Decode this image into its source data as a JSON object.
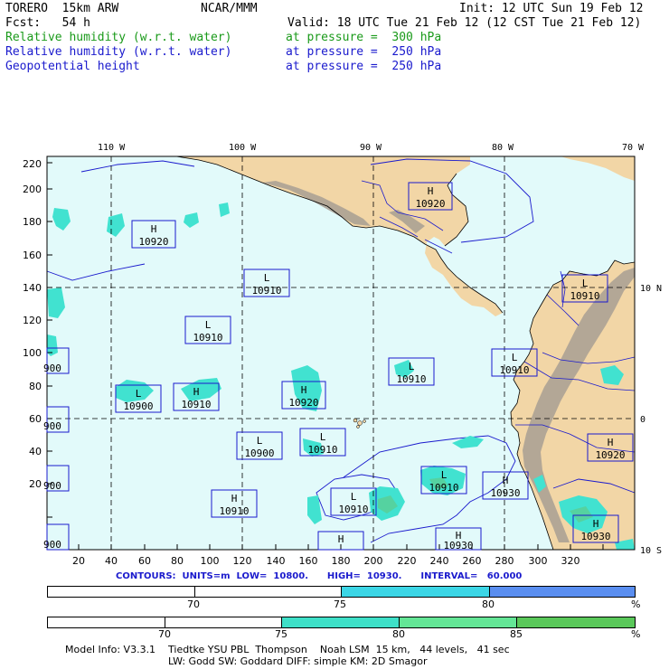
{
  "header": {
    "model": "TORERO  15km ARW",
    "org": "NCAR/MMM",
    "init": "Init: 12 UTC Sun 19 Feb 12",
    "fcst": "Fcst:   54 h",
    "valid": "Valid: 18 UTC Tue 21 Feb 12 (12 CST Tue 21 Feb 12)",
    "fields": [
      {
        "name": "Relative humidity (w.r.t. water)",
        "level": "at pressure =  300 hPa",
        "color": "#1a9a1a"
      },
      {
        "name": "Relative humidity (w.r.t. water)",
        "level": "at pressure =  250 hPa",
        "color": "#1a1acd"
      },
      {
        "name": "Geopotential height",
        "level": "at pressure =  250 hPa",
        "color": "#1a1acd"
      }
    ]
  },
  "map": {
    "lon_labels": [
      "110 W",
      "100 W",
      "90 W",
      "80 W",
      "70 W"
    ],
    "lat_labels": [
      "10 N",
      "0",
      "10 S"
    ],
    "x_ticks": [
      "20",
      "40",
      "60",
      "80",
      "100",
      "120",
      "140",
      "160",
      "180",
      "200",
      "220",
      "240",
      "260",
      "280",
      "300",
      "320"
    ],
    "y_ticks": [
      "220",
      "200",
      "180",
      "160",
      "140",
      "120",
      "100",
      "80",
      "60",
      "40",
      "20"
    ],
    "pressure_centers": [
      {
        "type": "H",
        "value": "10920"
      },
      {
        "type": "H",
        "value": "10920"
      },
      {
        "type": "L",
        "value": "10910"
      },
      {
        "type": "L",
        "value": "10910"
      },
      {
        "type": "L",
        "value": "10910"
      },
      {
        "type": "H",
        "value": "10910"
      },
      {
        "type": "L",
        "value": "10900"
      },
      {
        "type": "H",
        "value": "10920"
      },
      {
        "type": "L",
        "value": "10910"
      },
      {
        "type": "L",
        "value": "10910"
      },
      {
        "type": "L",
        "value": "10900"
      },
      {
        "type": "L",
        "value": "10910"
      },
      {
        "type": "L",
        "value": "10910"
      },
      {
        "type": "H",
        "value": "10910"
      },
      {
        "type": "L",
        "value": "10910"
      },
      {
        "type": "H",
        "value": "10930"
      },
      {
        "type": "H",
        "value": "10920"
      },
      {
        "type": "H",
        "value": "10930"
      },
      {
        "type": "H",
        "value": "10930"
      },
      {
        "type": "H",
        "value": "10930"
      }
    ],
    "edge_labels": [
      "900",
      "900",
      "900",
      "900",
      "900"
    ],
    "colors": {
      "ocean": "#e2fafa",
      "land": "#f2d6a6",
      "mountain": "#a89f93",
      "rh_cyan": "#41e2d0",
      "rh_green": "#55d2a0",
      "contour": "#1a1acd"
    }
  },
  "contours_text": "CONTOURS:  UNITS=m  LOW=  10800.      HIGH=  10930.      INTERVAL=   60.000",
  "legend1": {
    "labels": [
      "70",
      "75",
      "80",
      "%"
    ],
    "segments": [
      {
        "color": "#ffffff"
      },
      {
        "color": "#3cd6e6"
      },
      {
        "color": "#5a8ef0"
      }
    ]
  },
  "legend2": {
    "labels": [
      "70",
      "75",
      "80",
      "85",
      "%"
    ],
    "segments": [
      {
        "color": "#ffffff"
      },
      {
        "color": "#3ee0c8"
      },
      {
        "color": "#64e696"
      },
      {
        "color": "#5ac85a"
      }
    ]
  },
  "footer": {
    "line1": "Model Info: V3.3.1    Tiedtke YSU PBL  Thompson    Noah LSM  15 km,   44 levels,   41 sec",
    "line2": "LW: Godd SW: Goddard DIFF: simple KM: 2D Smagor"
  }
}
